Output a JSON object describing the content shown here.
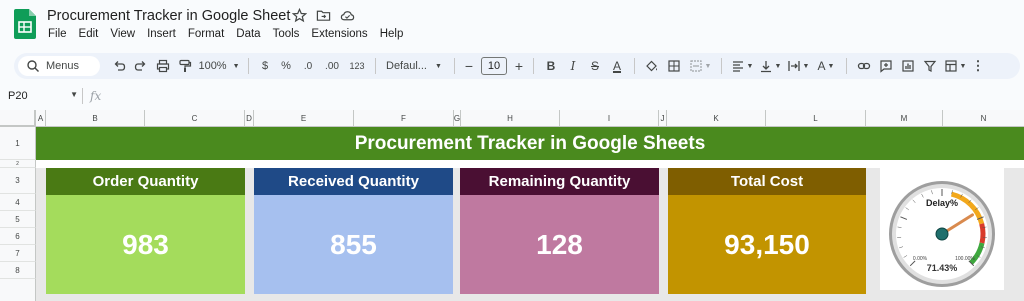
{
  "app": {
    "doc_title": "Procurement Tracker in Google Sheet",
    "menu": [
      "File",
      "Edit",
      "View",
      "Insert",
      "Format",
      "Data",
      "Tools",
      "Extensions",
      "Help"
    ]
  },
  "toolbar": {
    "menus_label": "Menus",
    "zoom": "100%",
    "currency": "$",
    "percent": "%",
    "dec_less": ".0",
    "dec_more": ".00",
    "number_format": "123",
    "font": "Defaul...",
    "font_size": "10"
  },
  "formula_bar": {
    "cell_ref": "P20",
    "fx": "fx"
  },
  "columns": [
    "A",
    "B",
    "C",
    "D",
    "E",
    "F",
    "G",
    "H",
    "I",
    "J",
    "K",
    "L",
    "M",
    "N"
  ],
  "rows": [
    "1",
    "2",
    "3",
    "4",
    "5",
    "6",
    "7",
    "8"
  ],
  "dashboard": {
    "title": "Procurement Tracker in Google Sheets",
    "cards": [
      {
        "label": "Order Quantity",
        "value": "983",
        "head_color": "#4a7a14",
        "body_color": "#a4dc5c"
      },
      {
        "label": "Received Quantity",
        "value": "855",
        "head_color": "#1f4a87",
        "body_color": "#a6c0ef"
      },
      {
        "label": "Remaining Quantity",
        "value": "128",
        "head_color": "#4a0f33",
        "body_color": "#bf79a0"
      },
      {
        "label": "Total Cost",
        "value": "93,150",
        "head_color": "#7f5e00",
        "body_color": "#c29400"
      }
    ],
    "gauge": {
      "title": "Delay%",
      "min_label": "0.00%",
      "max_label": "100.00%",
      "value_label": "71.43%",
      "value": 0.7143
    }
  }
}
